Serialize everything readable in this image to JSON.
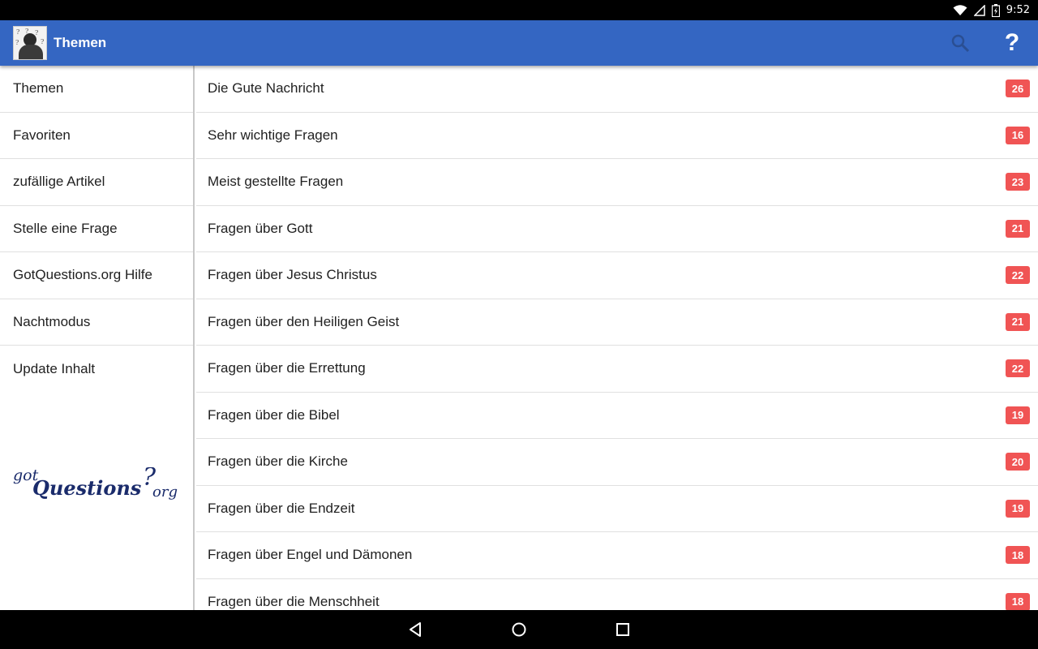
{
  "status_bar": {
    "time": "9:52",
    "icons": [
      "wifi-icon",
      "signal-icon",
      "battery-icon"
    ]
  },
  "app_bar": {
    "title": "Themen",
    "actions": [
      "search-icon",
      "help-icon"
    ],
    "help_glyph": "?",
    "color": "#3466c2"
  },
  "sidebar": {
    "items": [
      {
        "label": "Themen"
      },
      {
        "label": "Favoriten"
      },
      {
        "label": "zufällige Artikel"
      },
      {
        "label": "Stelle eine Frage"
      },
      {
        "label": "GotQuestions.org Hilfe"
      },
      {
        "label": "Nachtmodus"
      },
      {
        "label": "Update Inhalt"
      }
    ],
    "logo_text": "gotQuestions?org"
  },
  "topics": [
    {
      "label": "Die Gute Nachricht",
      "count": "26"
    },
    {
      "label": "Sehr wichtige Fragen",
      "count": "16"
    },
    {
      "label": "Meist gestellte Fragen",
      "count": "23"
    },
    {
      "label": "Fragen über Gott",
      "count": "21"
    },
    {
      "label": "Fragen über Jesus Christus",
      "count": "22"
    },
    {
      "label": "Fragen über den Heiligen Geist",
      "count": "21"
    },
    {
      "label": "Fragen über die Errettung",
      "count": "22"
    },
    {
      "label": "Fragen über die Bibel",
      "count": "19"
    },
    {
      "label": "Fragen über die Kirche",
      "count": "20"
    },
    {
      "label": "Fragen über die Endzeit",
      "count": "19"
    },
    {
      "label": "Fragen über Engel und Dämonen",
      "count": "18"
    },
    {
      "label": "Fragen über die Menschheit",
      "count": "18"
    }
  ],
  "badge_color": "#f05454",
  "nav_bar": {
    "buttons": [
      "back-icon",
      "home-icon",
      "recents-icon"
    ]
  }
}
